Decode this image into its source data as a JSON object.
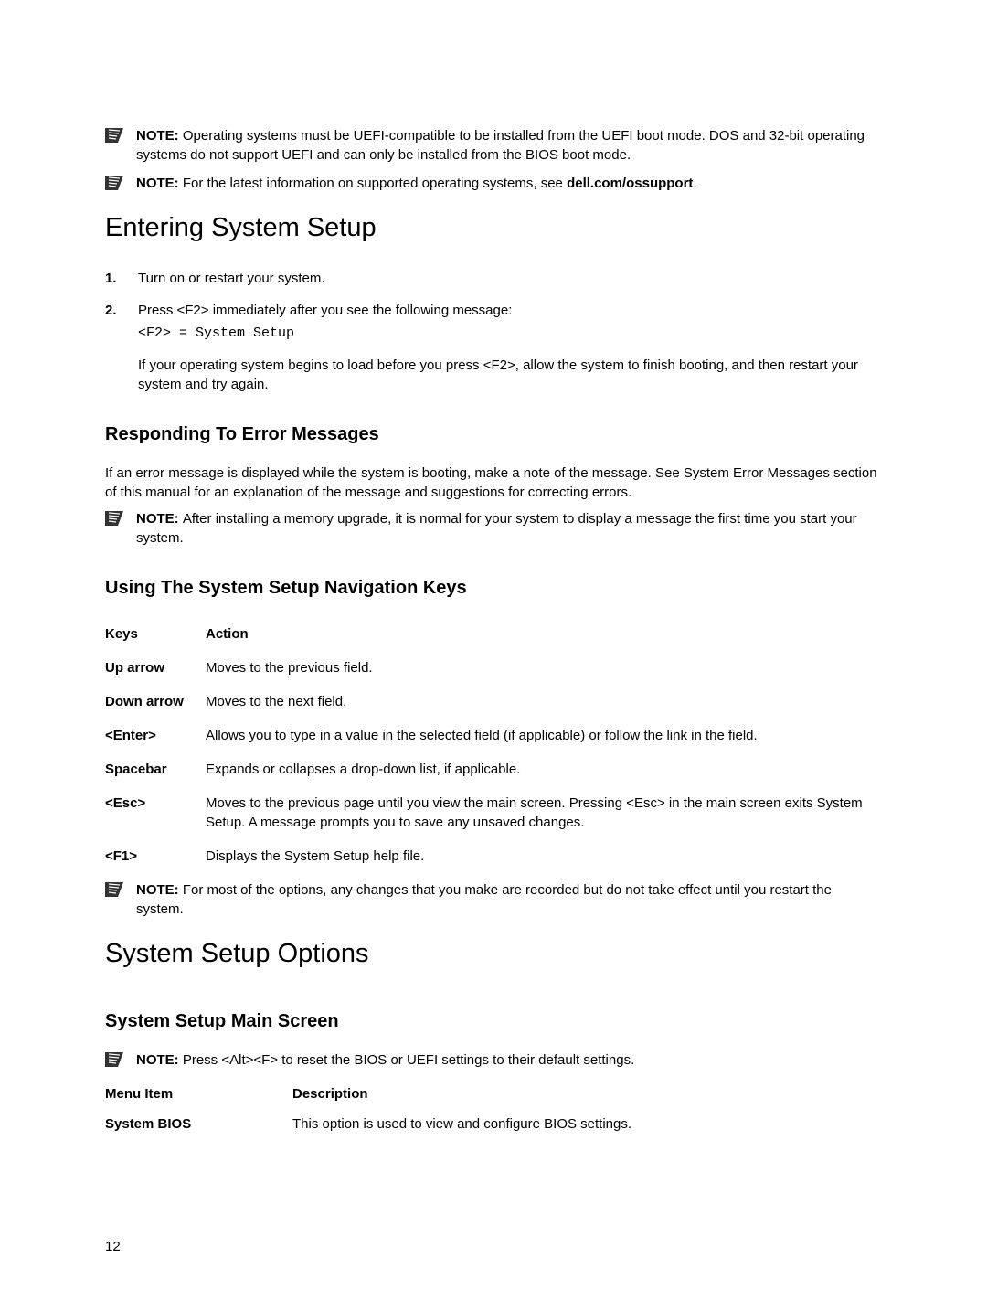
{
  "notes": {
    "note1_label": "NOTE: ",
    "note1_text": "Operating systems must be UEFI-compatible to be installed from the UEFI boot mode. DOS and 32-bit operating systems do not support UEFI and can only be installed from the BIOS boot mode.",
    "note2_label": "NOTE: ",
    "note2_text_before": "For the latest information on supported operating systems, see ",
    "note2_text_bold": "dell.com/ossupport",
    "note2_text_after": ".",
    "note3_label": "NOTE: ",
    "note3_text": "After installing a memory upgrade, it is normal for your system to display a message the first time you start your system.",
    "note4_label": "NOTE: ",
    "note4_text": "For most of the options, any changes that you make are recorded but do not take effect until you restart the system.",
    "note5_label": "NOTE: ",
    "note5_text": "Press <Alt><F> to reset the BIOS or UEFI settings to their default settings."
  },
  "headings": {
    "h1_entering": "Entering System Setup",
    "h2_responding": "Responding To Error Messages",
    "h2_navkeys": "Using The System Setup Navigation Keys",
    "h1_options": "System Setup Options",
    "h2_mainscreen": "System Setup Main Screen"
  },
  "steps": {
    "step1": "Turn on or restart your system.",
    "step2_intro": "Press <F2> immediately after you see the following message:",
    "step2_code": "<F2> = System Setup",
    "step2_followup": "If your operating system begins to load before you press <F2>, allow the system to finish booting, and then restart your system and try again."
  },
  "responding_para": "If an error message is displayed while the system is booting, make a note of the message. See System Error Messages section of this manual for an explanation of the message and suggestions for correcting errors.",
  "keys_table": {
    "header_keys": "Keys",
    "header_action": "Action",
    "rows": [
      {
        "key": "Up arrow",
        "action": "Moves to the previous field."
      },
      {
        "key": "Down arrow",
        "action": "Moves to the next field."
      },
      {
        "key": "<Enter>",
        "action": "Allows you to type in a value in the selected field (if applicable) or follow the link in the field."
      },
      {
        "key": "Spacebar",
        "action": "Expands or collapses a drop-down list, if applicable."
      },
      {
        "key": "<Esc>",
        "action": "Moves to the previous page until you view the main screen. Pressing <Esc> in the main screen exits System Setup. A message prompts you to save any unsaved changes."
      },
      {
        "key": "<F1>",
        "action": "Displays the System Setup help file."
      }
    ]
  },
  "menu_table": {
    "header_item": "Menu Item",
    "header_desc": "Description",
    "rows": [
      {
        "item": "System BIOS",
        "desc": "This option is used to view and configure BIOS settings."
      }
    ]
  },
  "page_number": "12"
}
